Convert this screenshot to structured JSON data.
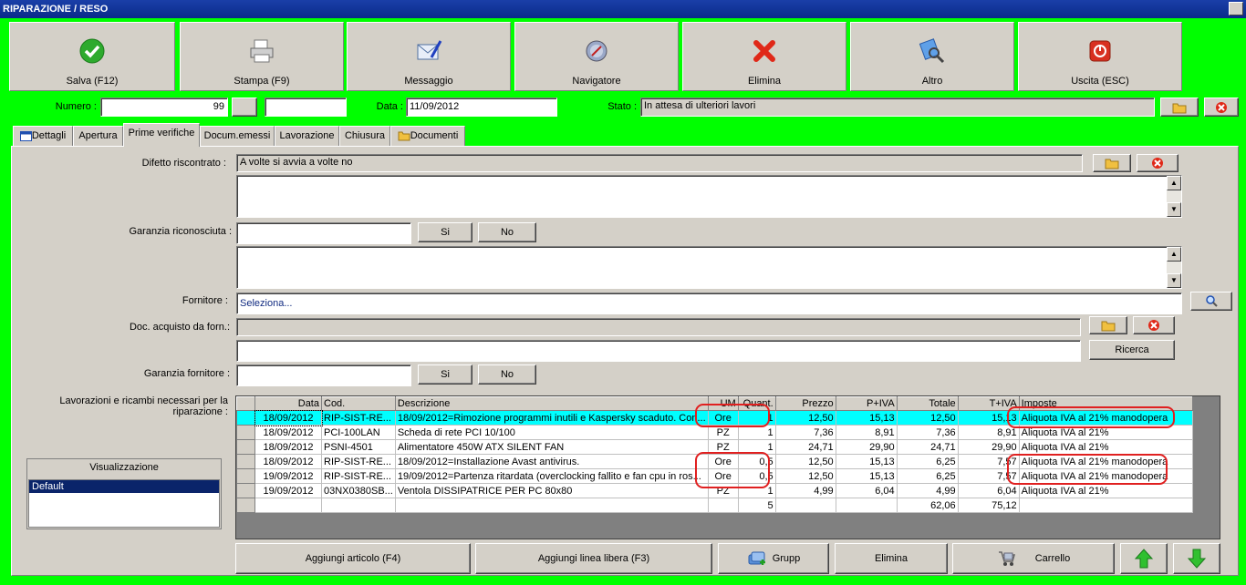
{
  "window": {
    "title": "RIPARAZIONE / RESO"
  },
  "toolbar": [
    {
      "label": "Salva (F12)",
      "icon": "check-icon"
    },
    {
      "label": "Stampa (F9)",
      "icon": "printer-icon"
    },
    {
      "label": "Messaggio",
      "icon": "envelope-pen-icon"
    },
    {
      "label": "Navigatore",
      "icon": "compass-icon"
    },
    {
      "label": "Elimina",
      "icon": "red-x-icon"
    },
    {
      "label": "Altro",
      "icon": "magnifier-icon"
    },
    {
      "label": "Uscita (ESC)",
      "icon": "power-icon"
    }
  ],
  "header": {
    "numero_label": "Numero :",
    "numero_value": "99",
    "numero_extra": "",
    "data_label": "Data :",
    "data_value": "11/09/2012",
    "stato_label": "Stato :",
    "stato_value": "In attesa di ulteriori lavori"
  },
  "tabs": [
    {
      "label": "Dettagli"
    },
    {
      "label": "Apertura"
    },
    {
      "label": "Prime verifiche"
    },
    {
      "label": "Docum.emessi"
    },
    {
      "label": "Lavorazione"
    },
    {
      "label": "Chiusura"
    },
    {
      "label": "Documenti"
    }
  ],
  "form": {
    "difetto_label": "Difetto riscontrato :",
    "difetto_value": "A volte si avvia a volte no",
    "garanzia_label": "Garanzia riconosciuta :",
    "garanzia_value": "",
    "si_label": "Si",
    "no_label": "No",
    "fornitore_label": "Fornitore :",
    "fornitore_value": "Seleziona...",
    "doc_acquisto_label": "Doc. acquisto da forn.:",
    "doc_acquisto_value": "",
    "doc_acquisto_extra": "",
    "ricerca_label": "Ricerca",
    "garanzia_fornitore_label": "Garanzia fornitore :",
    "garanzia_fornitore_value": "",
    "lavorazioni_label": "Lavorazioni e ricambi necessari per la riparazione :"
  },
  "visualizzazione": {
    "title": "Visualizzazione",
    "selected": "Default"
  },
  "grid": {
    "columns": [
      "Data",
      "Cod.",
      "Descrizione",
      "UM",
      "Quant.",
      "Prezzo",
      "P+IVA",
      "Totale",
      "T+IVA",
      "Imposte"
    ],
    "rows": [
      [
        "18/09/2012",
        "RIP-SIST-RE...",
        "18/09/2012=Rimozione programmi inutili e Kaspersky scaduto. Con...",
        "Ore",
        "1",
        "12,50",
        "15,13",
        "12,50",
        "15,13",
        "Aliquota IVA al 21% manodopera"
      ],
      [
        "18/09/2012",
        "PCI-100LAN",
        "Scheda di rete PCI 10/100",
        "PZ",
        "1",
        "7,36",
        "8,91",
        "7,36",
        "8,91",
        "Aliquota IVA al 21%"
      ],
      [
        "18/09/2012",
        "PSNI-4501",
        "Alimentatore 450W ATX SILENT FAN",
        "PZ",
        "1",
        "24,71",
        "29,90",
        "24,71",
        "29,90",
        "Aliquota IVA al 21%"
      ],
      [
        "18/09/2012",
        "RIP-SIST-RE...",
        "18/09/2012=Installazione Avast antivirus.",
        "Ore",
        "0,5",
        "12,50",
        "15,13",
        "6,25",
        "7,57",
        "Aliquota IVA al 21% manodopera"
      ],
      [
        "19/09/2012",
        "RIP-SIST-RE...",
        "19/09/2012=Partenza ritardata (overclocking fallito e fan cpu in ros...",
        "Ore",
        "0,5",
        "12,50",
        "15,13",
        "6,25",
        "7,57",
        "Aliquota IVA al 21% manodopera"
      ],
      [
        "19/09/2012",
        "03NX0380SB...",
        "Ventola DISSIPATRICE PER PC 80x80",
        "PZ",
        "1",
        "4,99",
        "6,04",
        "4,99",
        "6,04",
        "Aliquota IVA al 21%"
      ]
    ],
    "totals": [
      "",
      "",
      "",
      "",
      "5",
      "",
      "",
      "62,06",
      "75,12",
      ""
    ]
  },
  "bottom_buttons": {
    "aggiungi_articolo": "Aggiungi articolo (F4)",
    "aggiungi_linea": "Aggiungi linea libera (F3)",
    "gruppo": "Grupp",
    "elimina": "Elimina",
    "carrello": "Carrello"
  }
}
